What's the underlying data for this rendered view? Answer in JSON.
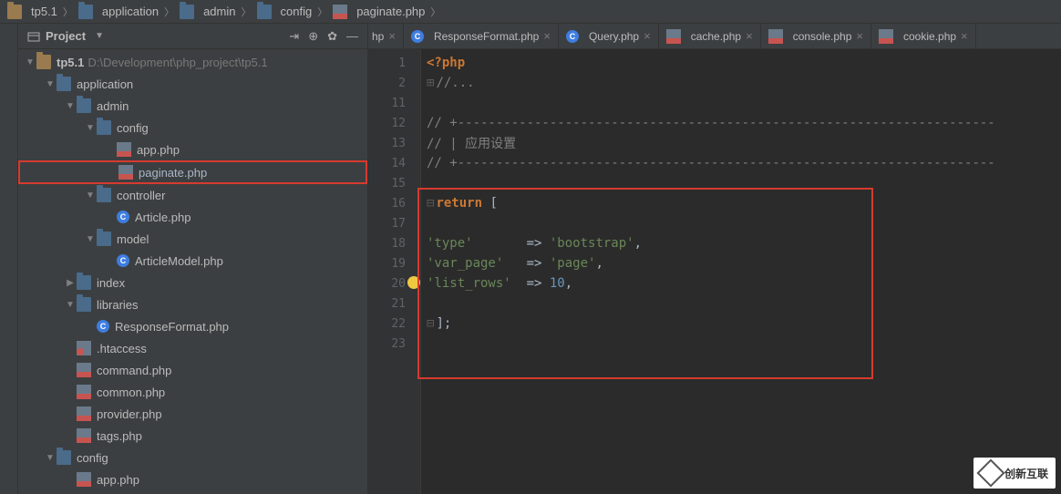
{
  "breadcrumb": {
    "items": [
      "tp5.1",
      "application",
      "admin",
      "config",
      "paginate.php"
    ]
  },
  "sidebar": {
    "title": "Project",
    "root": {
      "label": "tp5.1",
      "path": "D:\\Development\\php_project\\tp5.1"
    },
    "tree": {
      "application": "application",
      "admin": "admin",
      "config": "config",
      "app_php": "app.php",
      "paginate_php": "paginate.php",
      "controller": "controller",
      "article_php": "Article.php",
      "model": "model",
      "article_model_php": "ArticleModel.php",
      "index": "index",
      "libraries": "libraries",
      "response_format_php": "ResponseFormat.php",
      "htaccess": ".htaccess",
      "command_php": "command.php",
      "common_php": "common.php",
      "provider_php": "provider.php",
      "tags_php": "tags.php",
      "config2": "config",
      "app_php2": "app.php"
    }
  },
  "tabs": {
    "partial": "hp",
    "items": [
      {
        "label": "ResponseFormat.php",
        "icon": "class"
      },
      {
        "label": "Query.php",
        "icon": "class"
      },
      {
        "label": "cache.php",
        "icon": "php"
      },
      {
        "label": "console.php",
        "icon": "php"
      },
      {
        "label": "cookie.php",
        "icon": "php"
      }
    ]
  },
  "code": {
    "lines": [
      "1",
      "2",
      "11",
      "12",
      "13",
      "14",
      "15",
      "16",
      "17",
      "18",
      "19",
      "20",
      "21",
      "22",
      "23"
    ],
    "l1_tag": "<?php",
    "l2_comment": "//...",
    "l12_comment": "// +----------------------------------------------------------------------",
    "l13_comment": "// | 应用设置",
    "l14_comment": "// +----------------------------------------------------------------------",
    "l16_return": "return",
    "l16_bracket": " [",
    "l18_key": "'type'",
    "l18_arrow": "       => ",
    "l18_val": "'bootstrap'",
    "l18_comma": ",",
    "l19_key": "'var_page'",
    "l19_arrow": "   => ",
    "l19_val": "'page'",
    "l19_comma": ",",
    "l20_key": "'list_rows'",
    "l20_arrow": "  => ",
    "l20_val": "10",
    "l20_comma": ",",
    "l22_close": "];"
  },
  "watermark": {
    "text": "创新互联"
  }
}
